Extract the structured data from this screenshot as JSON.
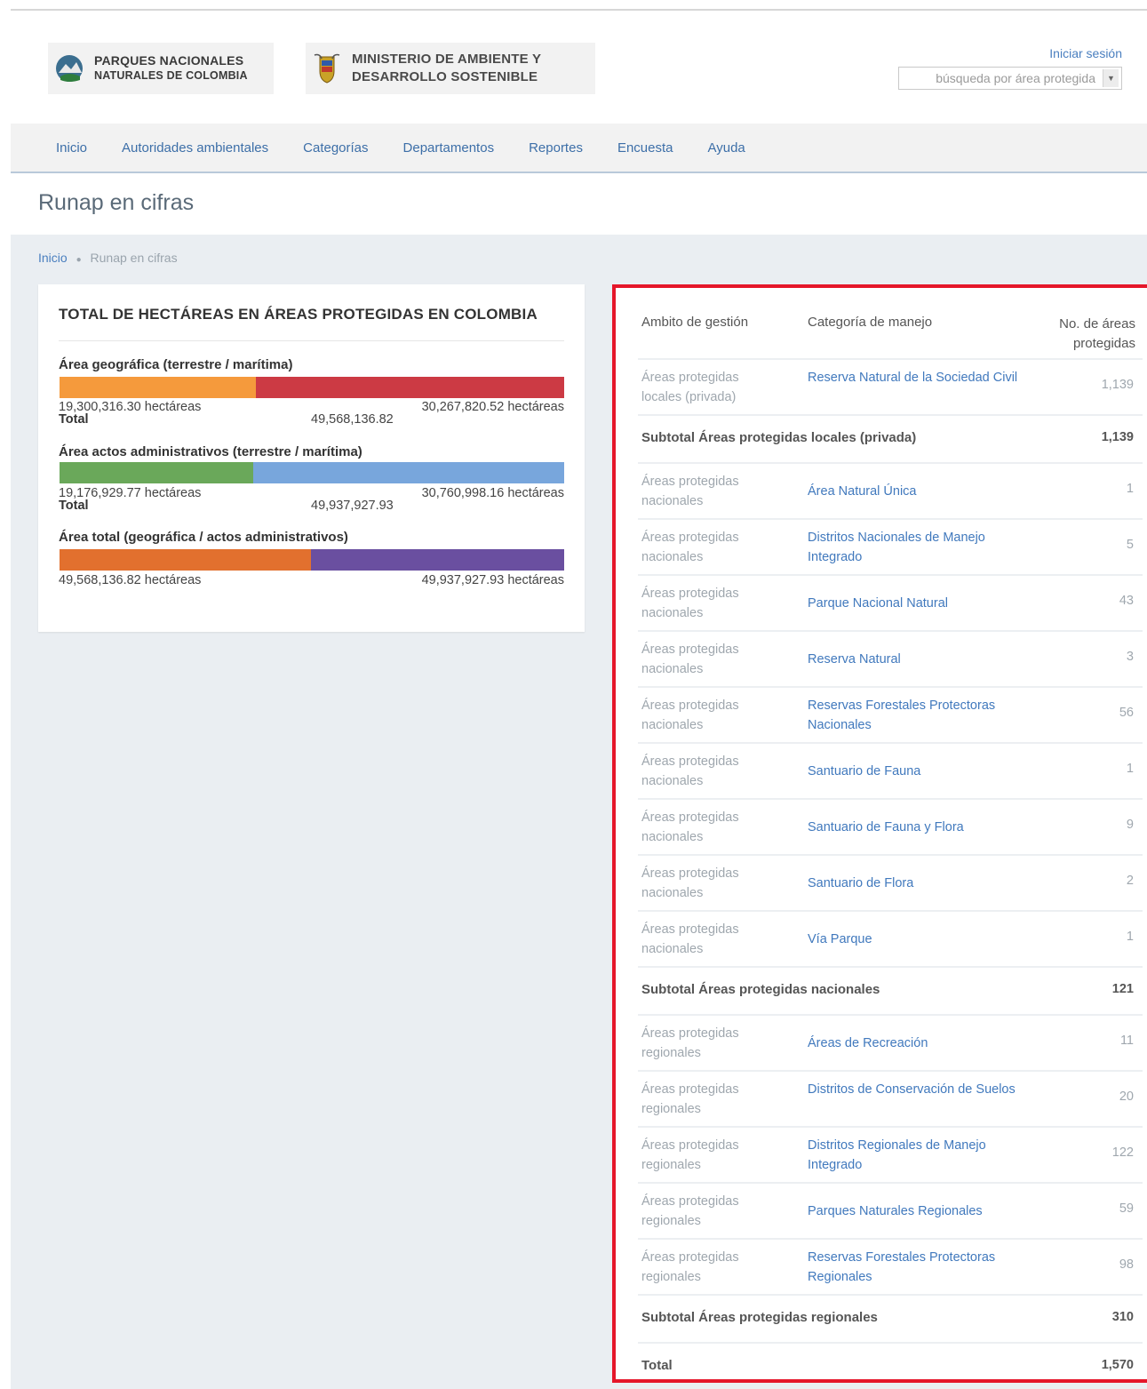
{
  "header": {
    "logo_pnn": {
      "line1": "PARQUES NACIONALES",
      "line2": "NATURALES DE COLOMBIA"
    },
    "logo_ministerio": {
      "line1": "MINISTERIO DE AMBIENTE Y",
      "line2": "DESARROLLO SOSTENIBLE"
    },
    "login_label": "Iniciar sesión",
    "search_placeholder": "búsqueda por área protegida"
  },
  "nav": {
    "items": [
      {
        "label": "Inicio"
      },
      {
        "label": "Autoridades ambientales"
      },
      {
        "label": "Categorías"
      },
      {
        "label": "Departamentos"
      },
      {
        "label": "Reportes"
      },
      {
        "label": "Encuesta"
      },
      {
        "label": "Ayuda"
      }
    ]
  },
  "page": {
    "title": "Runap en cifras",
    "breadcrumb": {
      "home": "Inicio",
      "current": "Runap en cifras"
    }
  },
  "summary": {
    "title": "TOTAL DE HECTÁREAS EN ÁREAS PROTEGIDAS EN COLOMBIA",
    "colors": {
      "geo_left": "#f59a3c",
      "geo_right": "#cc3a44",
      "adm_left": "#6aa85a",
      "adm_right": "#78a6dc",
      "tot_left": "#e2702e",
      "tot_right": "#6a4fa0"
    },
    "geografica": {
      "title": "Área geográfica (terrestre / marítima)",
      "left_value": "19,300,316.30 hectáreas",
      "right_value": "30,267,820.52 hectáreas",
      "total_label": "Total",
      "total_value": "49,568,136.82",
      "left_fraction": 0.389
    },
    "administrativos": {
      "title": "Área actos administrativos (terrestre / marítima)",
      "left_value": "19,176,929.77 hectáreas",
      "right_value": "30,760,998.16 hectáreas",
      "total_label": "Total",
      "total_value": "49,937,927.93",
      "left_fraction": 0.384
    },
    "total": {
      "title": "Área total (geográfica / actos administrativos)",
      "left_value": "49,568,136.82 hectáreas",
      "right_value": "49,937,927.93 hectáreas",
      "left_fraction": 0.498
    }
  },
  "table": {
    "headers": {
      "ambito": "Ambito de gestión",
      "categoria": "Categoría de manejo",
      "numero": "No. de áreas protegidas"
    },
    "rows": [
      {
        "ambito": "Áreas protegidas locales (privada)",
        "categoria": "Reserva Natural de la Sociedad Civil",
        "numero": "1,139"
      },
      {
        "subtotal": "Subtotal Áreas protegidas locales (privada)",
        "numero": "1,139"
      },
      {
        "ambito": "Áreas protegidas nacionales",
        "categoria": "Área Natural Única",
        "numero": "1"
      },
      {
        "ambito": "Áreas protegidas nacionales",
        "categoria": "Distritos Nacionales de Manejo Integrado",
        "numero": "5"
      },
      {
        "ambito": "Áreas protegidas nacionales",
        "categoria": "Parque Nacional Natural",
        "numero": "43"
      },
      {
        "ambito": "Áreas protegidas nacionales",
        "categoria": "Reserva Natural",
        "numero": "3"
      },
      {
        "ambito": "Áreas protegidas nacionales",
        "categoria": "Reservas Forestales Protectoras Nacionales",
        "numero": "56"
      },
      {
        "ambito": "Áreas protegidas nacionales",
        "categoria": "Santuario de Fauna",
        "numero": "1"
      },
      {
        "ambito": "Áreas protegidas nacionales",
        "categoria": "Santuario de Fauna y Flora",
        "numero": "9"
      },
      {
        "ambito": "Áreas protegidas nacionales",
        "categoria": "Santuario de Flora",
        "numero": "2"
      },
      {
        "ambito": "Áreas protegidas nacionales",
        "categoria": "Vía Parque",
        "numero": "1"
      },
      {
        "subtotal": "Subtotal Áreas protegidas nacionales",
        "numero": "121"
      },
      {
        "ambito": "Áreas protegidas regionales",
        "categoria": "Áreas de Recreación",
        "numero": "11"
      },
      {
        "ambito": "Áreas protegidas regionales",
        "categoria": "Distritos de Conservación de Suelos",
        "numero": "20"
      },
      {
        "ambito": "Áreas protegidas regionales",
        "categoria": "Distritos Regionales de Manejo Integrado",
        "numero": "122"
      },
      {
        "ambito": "Áreas protegidas regionales",
        "categoria": "Parques Naturales Regionales",
        "numero": "59"
      },
      {
        "ambito": "Áreas protegidas regionales",
        "categoria": "Reservas Forestales Protectoras Regionales",
        "numero": "98"
      },
      {
        "subtotal": "Subtotal Áreas protegidas regionales",
        "numero": "310"
      },
      {
        "subtotal": "Total",
        "numero": "1,570"
      }
    ]
  }
}
